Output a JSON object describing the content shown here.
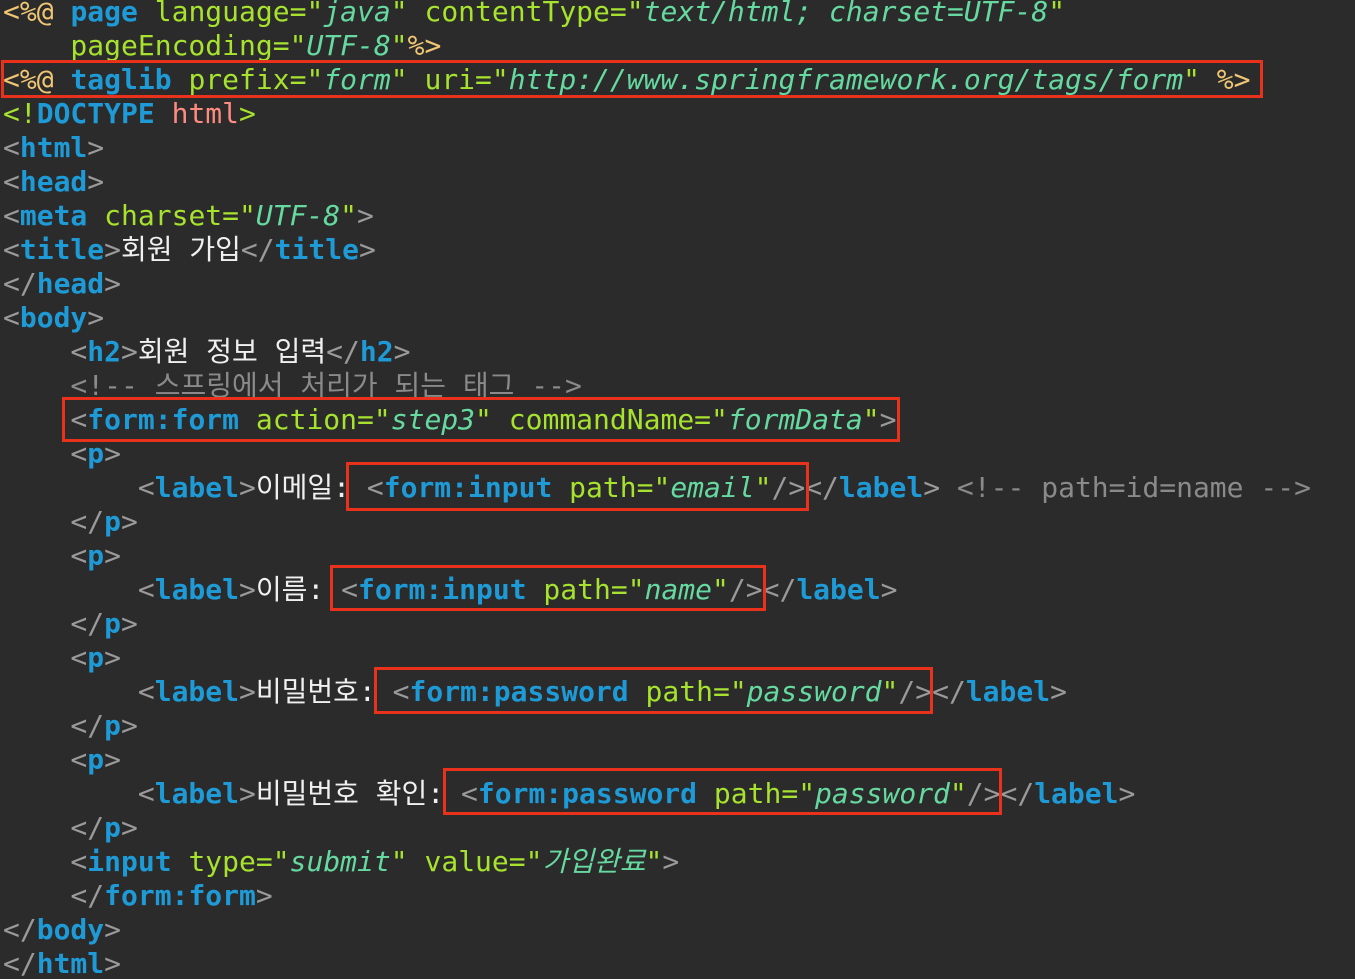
{
  "lines": [
    [
      {
        "t": "<%@ ",
        "c": "delim"
      },
      {
        "t": "page",
        "c": "pagekw"
      },
      {
        "t": " language=",
        "c": "attr"
      },
      {
        "t": "\"",
        "c": "str"
      },
      {
        "t": "java",
        "c": "val"
      },
      {
        "t": "\" contentType=",
        "c": "attr"
      },
      {
        "t": "\"",
        "c": "str"
      },
      {
        "t": "text/html; charset=UTF-8",
        "c": "val"
      },
      {
        "t": "\"",
        "c": "str"
      }
    ],
    [
      {
        "t": "    pageEncoding=",
        "c": "attr"
      },
      {
        "t": "\"",
        "c": "str"
      },
      {
        "t": "UTF-8",
        "c": "val"
      },
      {
        "t": "\"",
        "c": "str"
      },
      {
        "t": "%>",
        "c": "delim"
      }
    ],
    [
      {
        "t": "<%@ ",
        "c": "delim"
      },
      {
        "t": "taglib",
        "c": "pagekw"
      },
      {
        "t": " prefix=",
        "c": "attr"
      },
      {
        "t": "\"",
        "c": "str"
      },
      {
        "t": "form",
        "c": "val"
      },
      {
        "t": "\" uri=",
        "c": "attr"
      },
      {
        "t": "\"",
        "c": "str"
      },
      {
        "t": "http://www.springframework.org/tags/form",
        "c": "val"
      },
      {
        "t": "\" ",
        "c": "str"
      },
      {
        "t": "%>",
        "c": "delim"
      }
    ],
    [
      {
        "t": "<!",
        "c": "attr"
      },
      {
        "t": "DOCTYPE",
        "c": "doctype"
      },
      {
        "t": " html",
        "c": "doctype-arg"
      },
      {
        "t": ">",
        "c": "attr"
      }
    ],
    [
      {
        "t": "<",
        "c": "brk"
      },
      {
        "t": "html",
        "c": "tag"
      },
      {
        "t": ">",
        "c": "brk"
      }
    ],
    [
      {
        "t": "<",
        "c": "brk"
      },
      {
        "t": "head",
        "c": "tag"
      },
      {
        "t": ">",
        "c": "brk"
      }
    ],
    [
      {
        "t": "<",
        "c": "brk"
      },
      {
        "t": "meta",
        "c": "tag"
      },
      {
        "t": " charset=",
        "c": "attr"
      },
      {
        "t": "\"",
        "c": "str"
      },
      {
        "t": "UTF-8",
        "c": "val"
      },
      {
        "t": "\"",
        "c": "str"
      },
      {
        "t": ">",
        "c": "brk"
      }
    ],
    [
      {
        "t": "<",
        "c": "brk"
      },
      {
        "t": "title",
        "c": "tag"
      },
      {
        "t": ">",
        "c": "brk"
      },
      {
        "t": "회원 가입",
        "c": "text"
      },
      {
        "t": "</",
        "c": "brk"
      },
      {
        "t": "title",
        "c": "tag"
      },
      {
        "t": ">",
        "c": "brk"
      }
    ],
    [
      {
        "t": "</",
        "c": "brk"
      },
      {
        "t": "head",
        "c": "tag"
      },
      {
        "t": ">",
        "c": "brk"
      }
    ],
    [
      {
        "t": "<",
        "c": "brk"
      },
      {
        "t": "body",
        "c": "tag"
      },
      {
        "t": ">",
        "c": "brk"
      }
    ],
    [
      {
        "t": "    <",
        "c": "brk"
      },
      {
        "t": "h2",
        "c": "tag"
      },
      {
        "t": ">",
        "c": "brk"
      },
      {
        "t": "회원 정보 입력",
        "c": "text"
      },
      {
        "t": "</",
        "c": "brk"
      },
      {
        "t": "h2",
        "c": "tag"
      },
      {
        "t": ">",
        "c": "brk"
      }
    ],
    [
      {
        "t": "    <!-- 스프링에서 처리가 되는 태그 -->",
        "c": "comment"
      }
    ],
    [
      {
        "t": "    <",
        "c": "brk"
      },
      {
        "t": "form:form",
        "c": "tag"
      },
      {
        "t": " action=",
        "c": "attr"
      },
      {
        "t": "\"",
        "c": "str"
      },
      {
        "t": "step3",
        "c": "val"
      },
      {
        "t": "\" commandName=",
        "c": "attr"
      },
      {
        "t": "\"",
        "c": "str"
      },
      {
        "t": "formData",
        "c": "val"
      },
      {
        "t": "\"",
        "c": "str"
      },
      {
        "t": ">",
        "c": "brk"
      }
    ],
    [
      {
        "t": "    <",
        "c": "brk"
      },
      {
        "t": "p",
        "c": "tag"
      },
      {
        "t": ">",
        "c": "brk"
      }
    ],
    [
      {
        "t": "        <",
        "c": "brk"
      },
      {
        "t": "label",
        "c": "tag"
      },
      {
        "t": ">",
        "c": "brk"
      },
      {
        "t": "이메일: ",
        "c": "text"
      },
      {
        "t": "<",
        "c": "brk"
      },
      {
        "t": "form:input",
        "c": "tag"
      },
      {
        "t": " path=",
        "c": "attr"
      },
      {
        "t": "\"",
        "c": "str"
      },
      {
        "t": "email",
        "c": "val"
      },
      {
        "t": "\"",
        "c": "str"
      },
      {
        "t": "/>",
        "c": "brk"
      },
      {
        "t": "</",
        "c": "brk"
      },
      {
        "t": "label",
        "c": "tag"
      },
      {
        "t": ">",
        "c": "brk"
      },
      {
        "t": " <!-- path=id=name -->",
        "c": "comment"
      }
    ],
    [
      {
        "t": "    </",
        "c": "brk"
      },
      {
        "t": "p",
        "c": "tag"
      },
      {
        "t": ">",
        "c": "brk"
      }
    ],
    [
      {
        "t": "    <",
        "c": "brk"
      },
      {
        "t": "p",
        "c": "tag"
      },
      {
        "t": ">",
        "c": "brk"
      }
    ],
    [
      {
        "t": "        <",
        "c": "brk"
      },
      {
        "t": "label",
        "c": "tag"
      },
      {
        "t": ">",
        "c": "brk"
      },
      {
        "t": "이름: ",
        "c": "text"
      },
      {
        "t": "<",
        "c": "brk"
      },
      {
        "t": "form:input",
        "c": "tag"
      },
      {
        "t": " path=",
        "c": "attr"
      },
      {
        "t": "\"",
        "c": "str"
      },
      {
        "t": "name",
        "c": "val"
      },
      {
        "t": "\"",
        "c": "str"
      },
      {
        "t": "/>",
        "c": "brk"
      },
      {
        "t": "</",
        "c": "brk"
      },
      {
        "t": "label",
        "c": "tag"
      },
      {
        "t": ">",
        "c": "brk"
      }
    ],
    [
      {
        "t": "    </",
        "c": "brk"
      },
      {
        "t": "p",
        "c": "tag"
      },
      {
        "t": ">",
        "c": "brk"
      }
    ],
    [
      {
        "t": "    <",
        "c": "brk"
      },
      {
        "t": "p",
        "c": "tag"
      },
      {
        "t": ">",
        "c": "brk"
      }
    ],
    [
      {
        "t": "        <",
        "c": "brk"
      },
      {
        "t": "label",
        "c": "tag"
      },
      {
        "t": ">",
        "c": "brk"
      },
      {
        "t": "비밀번호: ",
        "c": "text"
      },
      {
        "t": "<",
        "c": "brk"
      },
      {
        "t": "form:password",
        "c": "tag"
      },
      {
        "t": " path=",
        "c": "attr"
      },
      {
        "t": "\"",
        "c": "str"
      },
      {
        "t": "password",
        "c": "val"
      },
      {
        "t": "\"",
        "c": "str"
      },
      {
        "t": "/>",
        "c": "brk"
      },
      {
        "t": "</",
        "c": "brk"
      },
      {
        "t": "label",
        "c": "tag"
      },
      {
        "t": ">",
        "c": "brk"
      }
    ],
    [
      {
        "t": "    </",
        "c": "brk"
      },
      {
        "t": "p",
        "c": "tag"
      },
      {
        "t": ">",
        "c": "brk"
      }
    ],
    [
      {
        "t": "    <",
        "c": "brk"
      },
      {
        "t": "p",
        "c": "tag"
      },
      {
        "t": ">",
        "c": "brk"
      }
    ],
    [
      {
        "t": "        <",
        "c": "brk"
      },
      {
        "t": "label",
        "c": "tag"
      },
      {
        "t": ">",
        "c": "brk"
      },
      {
        "t": "비밀번호 확인: ",
        "c": "text"
      },
      {
        "t": "<",
        "c": "brk"
      },
      {
        "t": "form:password",
        "c": "tag"
      },
      {
        "t": " path=",
        "c": "attr"
      },
      {
        "t": "\"",
        "c": "str"
      },
      {
        "t": "password",
        "c": "val"
      },
      {
        "t": "\"",
        "c": "str"
      },
      {
        "t": "/>",
        "c": "brk"
      },
      {
        "t": "</",
        "c": "brk"
      },
      {
        "t": "label",
        "c": "tag"
      },
      {
        "t": ">",
        "c": "brk"
      }
    ],
    [
      {
        "t": "    </",
        "c": "brk"
      },
      {
        "t": "p",
        "c": "tag"
      },
      {
        "t": ">",
        "c": "brk"
      }
    ],
    [
      {
        "t": "    <",
        "c": "brk"
      },
      {
        "t": "input",
        "c": "tag"
      },
      {
        "t": " type=",
        "c": "attr"
      },
      {
        "t": "\"",
        "c": "str"
      },
      {
        "t": "submit",
        "c": "val"
      },
      {
        "t": "\" value=",
        "c": "attr"
      },
      {
        "t": "\"",
        "c": "str"
      },
      {
        "t": "가입완료",
        "c": "val"
      },
      {
        "t": "\"",
        "c": "str"
      },
      {
        "t": ">",
        "c": "brk"
      }
    ],
    [
      {
        "t": "    </",
        "c": "brk"
      },
      {
        "t": "form:form",
        "c": "tag"
      },
      {
        "t": ">",
        "c": "brk"
      }
    ],
    [
      {
        "t": "</",
        "c": "brk"
      },
      {
        "t": "body",
        "c": "tag"
      },
      {
        "t": ">",
        "c": "brk"
      }
    ],
    [
      {
        "t": "</",
        "c": "brk"
      },
      {
        "t": "html",
        "c": "tag"
      },
      {
        "t": ">",
        "c": "brk"
      }
    ]
  ],
  "highlight_boxes": [
    {
      "name": "highlight-taglib-directive"
    },
    {
      "name": "highlight-form-form-tag"
    },
    {
      "name": "highlight-email-input"
    },
    {
      "name": "highlight-name-input"
    },
    {
      "name": "highlight-password-input"
    },
    {
      "name": "highlight-password-confirm-input"
    }
  ],
  "colors": {
    "background": "#2b2b2b",
    "highlight": "#e8321c",
    "tag": "#1e9ad6",
    "attr": "#a6e22e",
    "value": "#66d9a0",
    "delim": "#f0c674",
    "comment": "#8a8a8a"
  }
}
